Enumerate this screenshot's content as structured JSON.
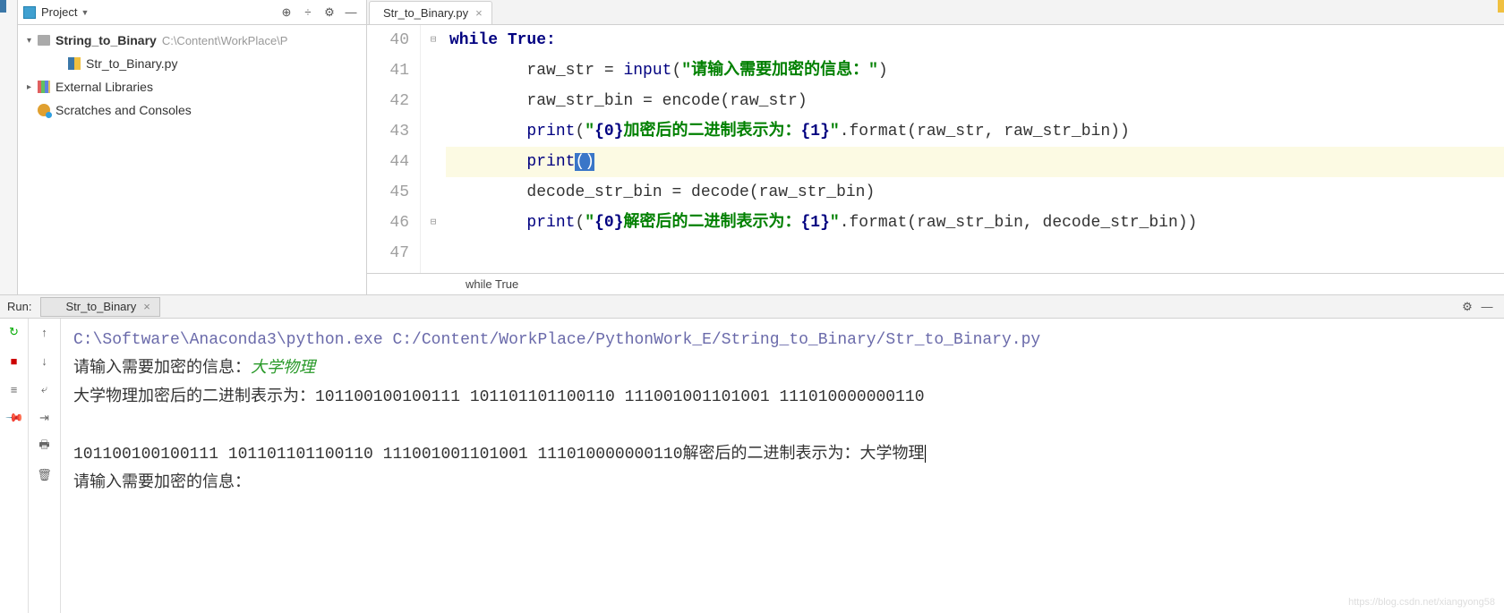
{
  "project_panel": {
    "title": "Project",
    "root_name": "String_to_Binary",
    "root_path": "C:\\Content\\WorkPlace\\P",
    "file_name": "Str_to_Binary.py",
    "external_libs": "External Libraries",
    "scratches": "Scratches and Consoles"
  },
  "editor": {
    "tab_name": "Str_to_Binary.py",
    "line_numbers": [
      "40",
      "41",
      "42",
      "43",
      "44",
      "45",
      "46",
      "47"
    ],
    "code": {
      "l40_kw_while": "while",
      "l40_rest": " True:",
      "l41_a": "        raw_str = ",
      "l41_fn": "input",
      "l41_b": "(",
      "l41_str": "\"请输入需要加密的信息：\"",
      "l41_c": ")",
      "l42": "        raw_str_bin = encode(raw_str)",
      "l43_a": "        ",
      "l43_fn": "print",
      "l43_b": "(",
      "l43_str1": "\"",
      "l43_fmt1": "{0}",
      "l43_str2": "加密后的二进制表示为：",
      "l43_fmt2": "{1}",
      "l43_str3": "\"",
      "l43_c": ".format(raw_str, raw_str_bin))",
      "l44_a": "        ",
      "l44_fn": "print",
      "l44_sel": "()",
      "l45": "        decode_str_bin = decode(raw_str_bin)",
      "l46_a": "        ",
      "l46_fn": "print",
      "l46_b": "(",
      "l46_str1": "\"",
      "l46_fmt1": "{0}",
      "l46_str2": "解密后的二进制表示为：",
      "l46_fmt2": "{1}",
      "l46_str3": "\"",
      "l46_c": ".format(raw_str_bin, decode_str_bin))"
    },
    "breadcrumb": "while True"
  },
  "run": {
    "label": "Run:",
    "tab": "Str_to_Binary",
    "console": {
      "cmd": "C:\\Software\\Anaconda3\\python.exe C:/Content/WorkPlace/PythonWork_E/String_to_Binary/Str_to_Binary.py",
      "prompt1": "请输入需要加密的信息：",
      "input1": "大学物理",
      "line2": "大学物理加密后的二进制表示为：101100100100111 101101101100110 111001001101001 111010000000110",
      "line3": "101100100100111 101101101100110 111001001101001 111010000000110解密后的二进制表示为：大学物理",
      "prompt2": "请输入需要加密的信息："
    }
  },
  "watermark": "https://blog.csdn.net/xiangyong58"
}
